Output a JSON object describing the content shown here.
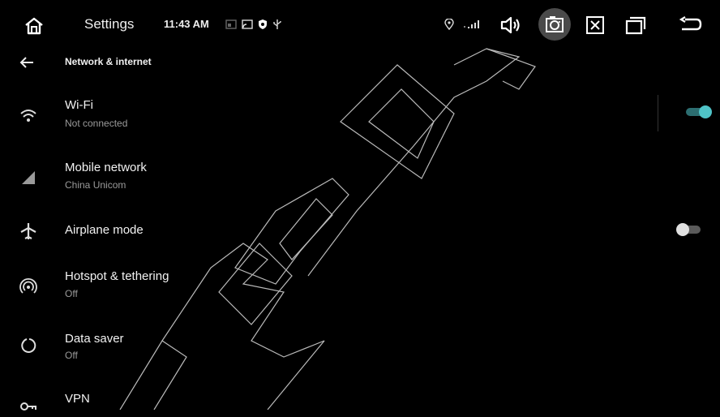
{
  "statusbar": {
    "title": "Settings",
    "time": "11:43 AM",
    "icons": [
      "home-icon",
      "cast-icon",
      "screen-mirror-icon",
      "shield-icon",
      "usb-icon",
      "location-icon",
      "signal-icon",
      "volume-icon",
      "camera-icon",
      "close-icon",
      "recent-apps-icon",
      "back-icon"
    ]
  },
  "header": {
    "back_icon": "arrow-left-icon",
    "title": "Network & internet"
  },
  "items": [
    {
      "icon": "wifi-icon",
      "title": "Wi-Fi",
      "subtitle": "Not connected",
      "toggle": true
    },
    {
      "icon": "cell-signal-icon",
      "title": "Mobile network",
      "subtitle": "China Unicom"
    },
    {
      "icon": "airplane-icon",
      "title": "Airplane mode",
      "toggle": false
    },
    {
      "icon": "hotspot-icon",
      "title": "Hotspot & tethering",
      "subtitle": "Off"
    },
    {
      "icon": "data-saver-icon",
      "title": "Data saver",
      "subtitle": "Off"
    },
    {
      "icon": "vpn-key-icon",
      "title": "VPN"
    }
  ],
  "colors": {
    "background": "#000000",
    "accent": "#4fc3c7",
    "toggle_off_knob": "#e0e0e0",
    "toggle_off_track": "#5a5a5a"
  }
}
